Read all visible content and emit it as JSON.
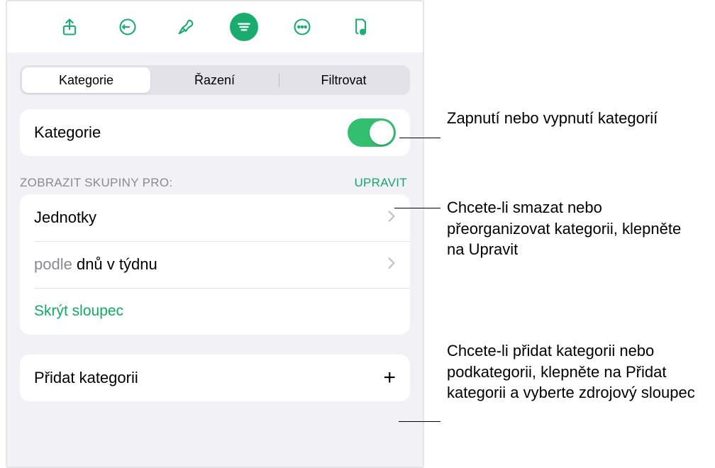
{
  "tabs": {
    "categories": "Kategorie",
    "sort": "Řazení",
    "filter": "Filtrovat"
  },
  "categoryToggle": {
    "label": "Kategorie"
  },
  "groupsHeader": {
    "label": "ZOBRAZIT SKUPINY PRO:",
    "edit": "UPRAVIT"
  },
  "groups": {
    "item1": "Jednotky",
    "item2_prefix": "podle ",
    "item2_value": "dnů v týdnu",
    "hide": "Skrýt sloupec"
  },
  "addCategory": {
    "label": "Přidat kategorii"
  },
  "callouts": {
    "c1": "Zapnutí nebo vypnutí kategorií",
    "c2": "Chcete-li smazat nebo přeorganizovat kategorii, klepněte na Upravit",
    "c3": "Chcete-li přidat kategorii nebo podkategorii, klepněte na Přidat kategorii a vyberte zdrojový sloupec"
  }
}
